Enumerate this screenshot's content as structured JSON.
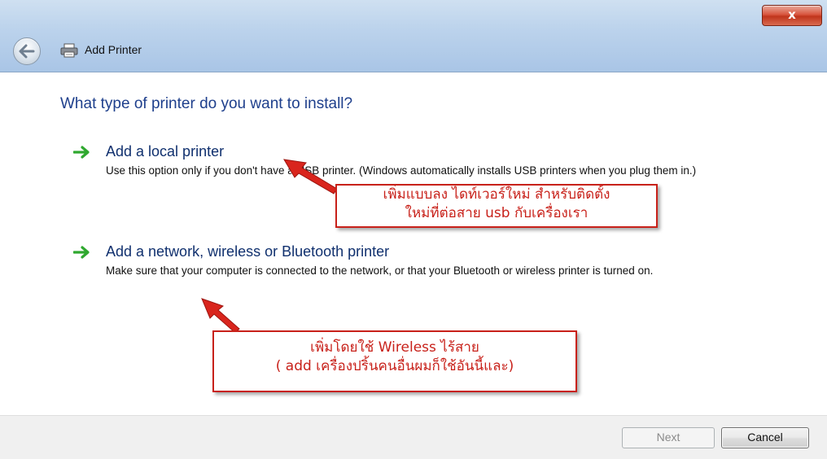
{
  "window": {
    "title": "Add Printer",
    "close_label": "x"
  },
  "main": {
    "heading": "What type of printer do you want to install?",
    "options": [
      {
        "title": "Add a local printer",
        "description": "Use this option only if you don't have a USB printer. (Windows automatically installs USB printers when you plug them in.)"
      },
      {
        "title": "Add a network, wireless or Bluetooth printer",
        "description": "Make sure that your computer is connected to the network, or that your Bluetooth or wireless printer is turned on."
      }
    ]
  },
  "annotations": [
    {
      "line1": "เพิ่มแบบลง ไดท์เวอร์ใหม่ สำหรับติดตั้ง",
      "line2": "ใหม่ที่ต่อสาย usb กับเครื่องเรา"
    },
    {
      "line1": "เพิ่มโดยใช้ Wireless ไร้สาย",
      "line2": "( add เครื่องปริ้นคนอื่นผมก็ใช้อันนี้และ)"
    }
  ],
  "footer": {
    "next_label": "Next",
    "cancel_label": "Cancel"
  },
  "colors": {
    "heading": "#1e3f8c",
    "annotation": "#c8211a",
    "option_arrow": "#2fa82f",
    "close_button": "#c0341c"
  },
  "icons": [
    "back-arrow-icon",
    "printer-icon",
    "green-arrow-icon",
    "close-icon"
  ]
}
